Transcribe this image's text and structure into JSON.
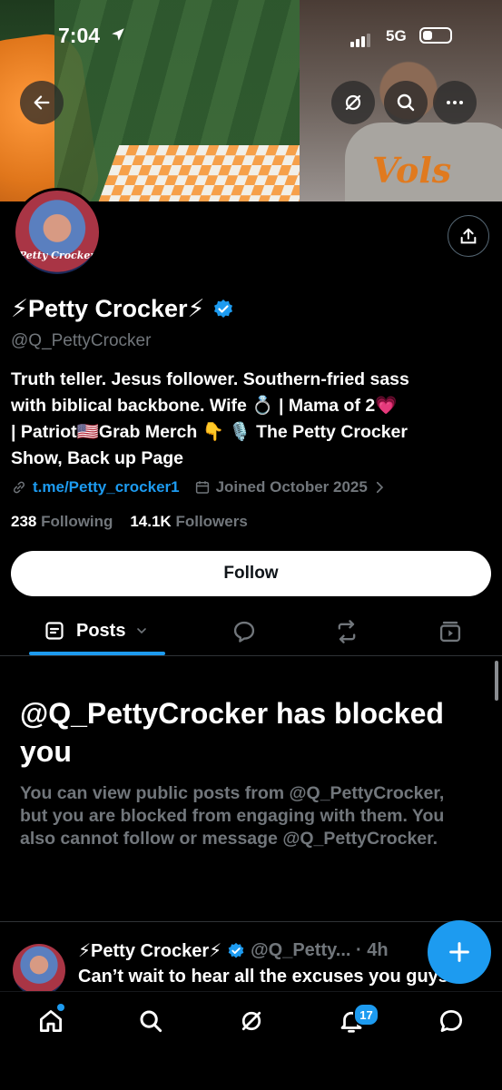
{
  "status_bar": {
    "time": "7:04",
    "network": "5G"
  },
  "profile": {
    "avatar_text": "Petty Crocker",
    "display_name": "⚡Petty Crocker⚡",
    "handle": "@Q_PettyCrocker",
    "bio_lines": [
      "Truth teller. Jesus follower. Southern-fried sass",
      "with biblical backbone. Wife 💍 | Mama of 2💗",
      "| Patriot🇺🇸Grab Merch 👇 🎙️ The Petty Crocker",
      "Show, Back up Page"
    ],
    "link": "t.me/Petty_crocker1",
    "joined": "Joined October 2025",
    "following_count": "238",
    "following_label": "Following",
    "followers_count": "14.1K",
    "followers_label": "Followers"
  },
  "follow_button": "Follow",
  "tabs": {
    "posts_label": "Posts"
  },
  "blocked": {
    "title": "@Q_PettyCrocker has blocked you",
    "description": "You can view public posts from @Q_PettyCrocker, but you are blocked from engaging with them. You also cannot follow or message @Q_PettyCrocker."
  },
  "tweet": {
    "name": "⚡Petty Crocker⚡",
    "handle_time": "@Q_Petty... · 4h",
    "text": "Can’t wait to hear all the excuses you guys"
  },
  "banner": {
    "shirt_text": "Vols"
  },
  "notifications_badge": "17",
  "colors": {
    "accent": "#1d9bf0",
    "background": "#000000",
    "muted": "#71767b"
  },
  "icons": [
    "back-arrow-icon",
    "grok-icon",
    "search-icon",
    "more-icon",
    "share-icon",
    "verified-icon",
    "link-icon",
    "calendar-icon",
    "chevron-right-icon",
    "posts-icon",
    "chevron-down-icon",
    "reply-icon",
    "retweet-icon",
    "media-icon",
    "compose-icon",
    "home-icon",
    "notifications-icon",
    "messages-icon"
  ]
}
